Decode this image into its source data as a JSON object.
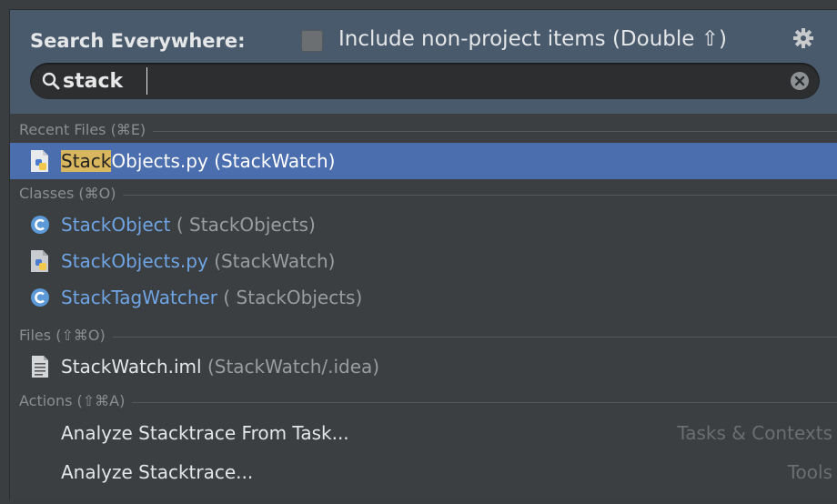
{
  "header": {
    "title": "Search Everywhere:",
    "include_label": "Include non-project items (Double ⇧)",
    "include_checked": false
  },
  "search": {
    "value": "stack",
    "placeholder": ""
  },
  "sections": {
    "recent_files": "Recent Files (⌘E)",
    "classes": "Classes (⌘O)",
    "files": "Files (⇧⌘O)",
    "actions": "Actions (⇧⌘A)"
  },
  "recent_files": [
    {
      "name_match": "Stack",
      "name_rest": "Objects.py",
      "location": "(StackWatch)",
      "icon": "python-file-icon"
    }
  ],
  "classes": [
    {
      "name": "StackObject",
      "location": "( StackObjects)",
      "icon": "class-icon"
    },
    {
      "name": "StackObjects.py",
      "location": "(StackWatch)",
      "icon": "python-file-icon"
    },
    {
      "name": "StackTagWatcher",
      "location": "( StackObjects)",
      "icon": "class-icon"
    }
  ],
  "files": [
    {
      "name": "StackWatch.iml",
      "location": "(StackWatch/.idea)",
      "icon": "document-icon"
    }
  ],
  "actions": [
    {
      "name": "Analyze Stacktrace From Task...",
      "category": "Tasks & Contexts"
    },
    {
      "name": "Analyze Stacktrace...",
      "category": "Tools"
    }
  ],
  "colors": {
    "header_bg": "#4a5a6d",
    "selection_bg": "#4b6eaf",
    "link": "#6fa5e4",
    "highlight": "#d9b75e"
  }
}
